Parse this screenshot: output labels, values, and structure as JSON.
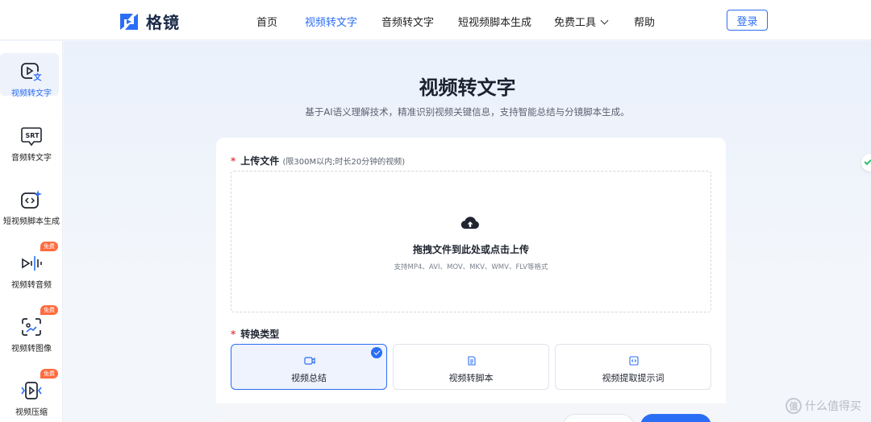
{
  "brand": {
    "name": "格镜"
  },
  "nav": {
    "items": [
      {
        "label": "首页"
      },
      {
        "label": "视频转文字"
      },
      {
        "label": "音频转文字"
      },
      {
        "label": "短视频脚本生成"
      },
      {
        "label": "免费工具"
      },
      {
        "label": "帮助"
      }
    ],
    "login_label": "登录"
  },
  "sidebar": {
    "items": [
      {
        "label": "视频转文字",
        "icon": "video-text-icon"
      },
      {
        "label": "音频转文字",
        "icon": "srt-icon",
        "icon_text": "SRT"
      },
      {
        "label": "短视频脚本生成",
        "icon": "code-sparkle-icon"
      },
      {
        "label": "视频转音频",
        "icon": "audio-wave-icon",
        "badge": "免费"
      },
      {
        "label": "视频转图像",
        "icon": "image-scan-icon",
        "badge": "免费"
      },
      {
        "label": "视频压缩",
        "icon": "compress-icon",
        "badge": "免费"
      }
    ]
  },
  "main": {
    "title": "视频转文字",
    "subtitle": "基于AI语义理解技术，精准识别视频关键信息，支持智能总结与分镜脚本生成。"
  },
  "upload": {
    "label": "上传文件",
    "hint": "(限300M以内;时长20分钟的视频)",
    "drop_text": "拖拽文件到此处或点击上传",
    "formats": "支持MP4、AVI、MOV、MKV、WMV、FLV等格式"
  },
  "conversion": {
    "label": "转换类型",
    "options": [
      {
        "label": "视频总结",
        "icon": "video-camera-icon",
        "selected": true
      },
      {
        "label": "视频转脚本",
        "icon": "document-icon",
        "selected": false
      },
      {
        "label": "视频提取提示词",
        "icon": "code-box-icon",
        "selected": false
      }
    ]
  },
  "watermark": {
    "text": "什么值得买",
    "mark": "值"
  },
  "colors": {
    "accent": "#2b6ef6",
    "badge": "#ff6b3d",
    "required": "#e5484d"
  }
}
